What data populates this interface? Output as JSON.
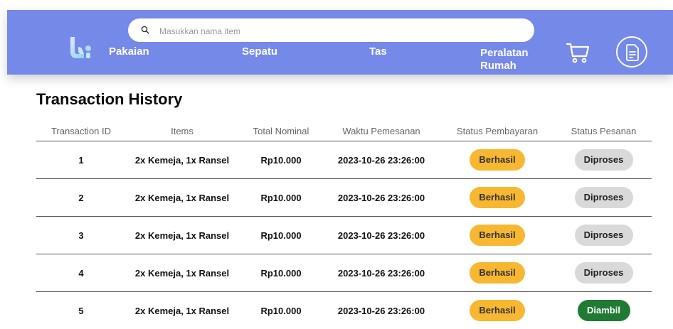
{
  "header": {
    "search_placeholder": "Masukkan nama item",
    "nav": [
      "Pakaian",
      "Sepatu",
      "Tas",
      "Peralatan Rumah"
    ]
  },
  "page_title": "Transaction History",
  "table": {
    "columns": [
      "Transaction ID",
      "Items",
      "Total Nominal",
      "Waktu Pemesanan",
      "Status Pembayaran",
      "Status Pesanan"
    ],
    "rows": [
      {
        "id": "1",
        "items": "2x Kemeja, 1x Ransel",
        "total": "Rp10.000",
        "time": "2023-10-26 23:26:00",
        "payment": "Berhasil",
        "order": "Diproses"
      },
      {
        "id": "2",
        "items": "2x Kemeja, 1x Ransel",
        "total": "Rp10.000",
        "time": "2023-10-26 23:26:00",
        "payment": "Berhasil",
        "order": "Diproses"
      },
      {
        "id": "3",
        "items": "2x Kemeja, 1x Ransel",
        "total": "Rp10.000",
        "time": "2023-10-26 23:26:00",
        "payment": "Berhasil",
        "order": "Diproses"
      },
      {
        "id": "4",
        "items": "2x Kemeja, 1x Ransel",
        "total": "Rp10.000",
        "time": "2023-10-26 23:26:00",
        "payment": "Berhasil",
        "order": "Diproses"
      },
      {
        "id": "5",
        "items": "2x Kemeja, 1x Ransel",
        "total": "Rp10.000",
        "time": "2023-10-26 23:26:00",
        "payment": "Berhasil",
        "order": "Diambil"
      }
    ]
  },
  "colors": {
    "navbar": "#7589e8",
    "payment_badge": "#f7b731",
    "order_processing": "#d9d9d9",
    "order_taken": "#1f7a34"
  }
}
